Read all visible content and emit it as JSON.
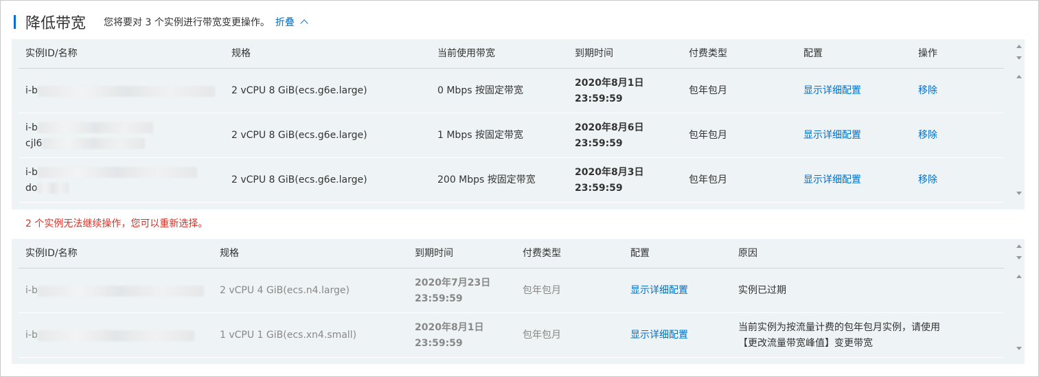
{
  "header": {
    "title": "降低带宽",
    "description": "您将要对 3 个实例进行带宽变更操作。",
    "fold_label": "折叠"
  },
  "table1": {
    "columns": [
      "实例ID/名称",
      "规格",
      "当前使用带宽",
      "到期时间",
      "付费类型",
      "配置",
      "操作"
    ],
    "rows": [
      {
        "id_prefix": "i-b",
        "id_line2": "",
        "spec": "2 vCPU 8 GiB(ecs.g6e.large)",
        "bandwidth": "0 Mbps 按固定带宽",
        "expire_date": "2020年8月1日",
        "expire_time": "23:59:59",
        "pay_type": "包年包月",
        "config": "显示详细配置",
        "action": "移除"
      },
      {
        "id_prefix": "i-b",
        "id_line2": "cjl6",
        "spec": "2 vCPU 8 GiB(ecs.g6e.large)",
        "bandwidth": "1 Mbps 按固定带宽",
        "expire_date": "2020年8月6日",
        "expire_time": "23:59:59",
        "pay_type": "包年包月",
        "config": "显示详细配置",
        "action": "移除"
      },
      {
        "id_prefix": "i-b",
        "id_line2": "do",
        "spec": "2 vCPU 8 GiB(ecs.g6e.large)",
        "bandwidth": "200 Mbps 按固定带宽",
        "expire_date": "2020年8月3日",
        "expire_time": "23:59:59",
        "pay_type": "包年包月",
        "config": "显示详细配置",
        "action": "移除"
      }
    ]
  },
  "warning": "2 个实例无法继续操作，您可以重新选择。",
  "table2": {
    "columns": [
      "实例ID/名称",
      "规格",
      "到期时间",
      "付费类型",
      "配置",
      "原因"
    ],
    "rows": [
      {
        "id_prefix": "i-b",
        "spec": "2 vCPU 4 GiB(ecs.n4.large)",
        "expire_date": "2020年7月23日",
        "expire_time": "23:59:59",
        "pay_type": "包年包月",
        "config": "显示详细配置",
        "reason_line1": "实例已过期",
        "reason_line2": ""
      },
      {
        "id_prefix": "i-b",
        "spec": "1 vCPU 1 GiB(ecs.xn4.small)",
        "expire_date": "2020年8月1日",
        "expire_time": "23:59:59",
        "pay_type": "包年包月",
        "config": "显示详细配置",
        "reason_line1": "当前实例为按流量计费的包年包月实例，请使用",
        "reason_line2": "【更改流量带宽峰值】变更带宽"
      }
    ]
  },
  "colors": {
    "accent": "#0070cc",
    "warning": "#d93026",
    "panel_bg": "#eef3f5"
  }
}
